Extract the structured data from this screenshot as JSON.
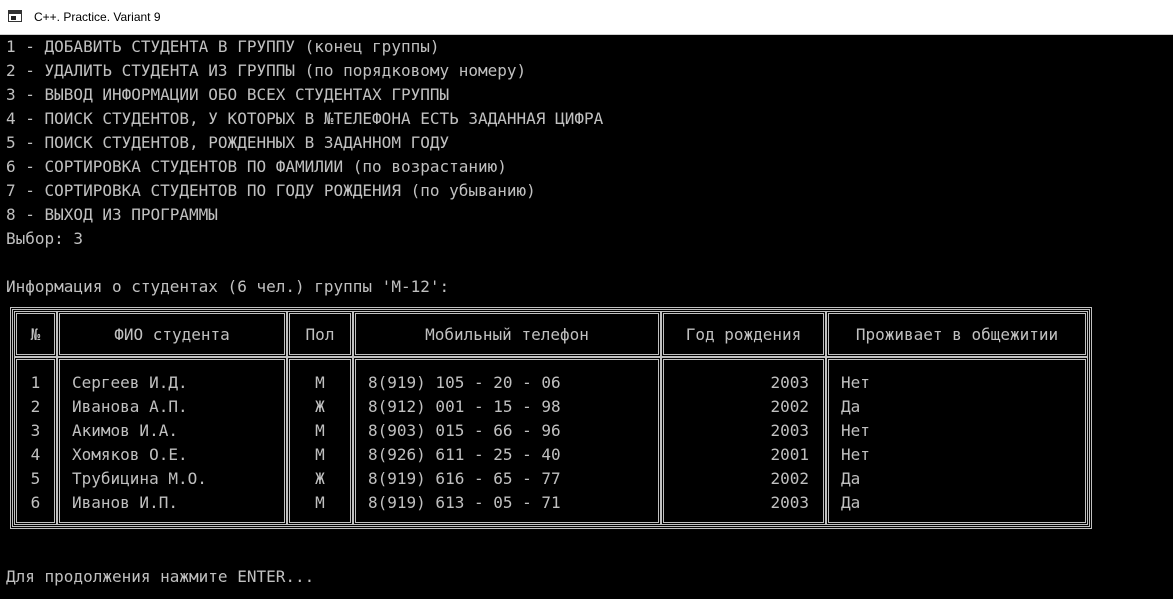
{
  "window": {
    "title": "C++. Practice. Variant 9"
  },
  "menu": [
    "1 - ДОБАВИТЬ СТУДЕНТА В ГРУППУ (конец группы)",
    "2 - УДАЛИТЬ СТУДЕНТА ИЗ ГРУППЫ (по порядковому номеру)",
    "3 - ВЫВОД ИНФОРМАЦИИ ОБО ВСЕХ СТУДЕНТАХ ГРУППЫ",
    "4 - ПОИСК СТУДЕНТОВ, У КОТОРЫХ В №ТЕЛЕФОНА ЕСТЬ ЗАДАННАЯ ЦИФРА",
    "5 - ПОИСК СТУДЕНТОВ, РОЖДЕННЫХ В ЗАДАННОМ ГОДУ",
    "6 - СОРТИРОВКА СТУДЕНТОВ ПО ФАМИЛИИ (по возрастанию)",
    "7 - СОРТИРОВКА СТУДЕНТОВ ПО ГОДУ РОЖДЕНИЯ (по убыванию)",
    "8 - ВЫХОД ИЗ ПРОГРАММЫ"
  ],
  "choice_line": "Выбор: 3",
  "info_line": "Информация о студентах (6 чел.) группы 'М-12':",
  "table": {
    "headers": [
      "№",
      "ФИО студента",
      "Пол",
      "Мобильный телефон",
      "Год рождения",
      "Проживает в общежитии"
    ],
    "rows": [
      [
        "1",
        "Сергеев И.Д.",
        "М",
        "8(919) 105 - 20 - 06",
        "2003",
        "Нет"
      ],
      [
        "2",
        "Иванова А.П.",
        "Ж",
        "8(912) 001 - 15 - 98",
        "2002",
        "Да"
      ],
      [
        "3",
        "Акимов И.А.",
        "М",
        "8(903) 015 - 66 - 96",
        "2003",
        "Нет"
      ],
      [
        "4",
        "Хомяков О.Е.",
        "М",
        "8(926) 611 - 25 - 40",
        "2001",
        "Нет"
      ],
      [
        "5",
        "Трубицина М.О.",
        "Ж",
        "8(919) 616 - 65 - 77",
        "2002",
        "Да"
      ],
      [
        "6",
        "Иванов И.П.",
        "М",
        "8(919) 613 - 05 - 71",
        "2003",
        "Да"
      ]
    ]
  },
  "footer_line": "Для продолжения нажмите ENTER...",
  "colors": {
    "console_bg": "#000000",
    "console_fg": "#c0c0c0",
    "titlebar_bg": "#ffffff"
  }
}
